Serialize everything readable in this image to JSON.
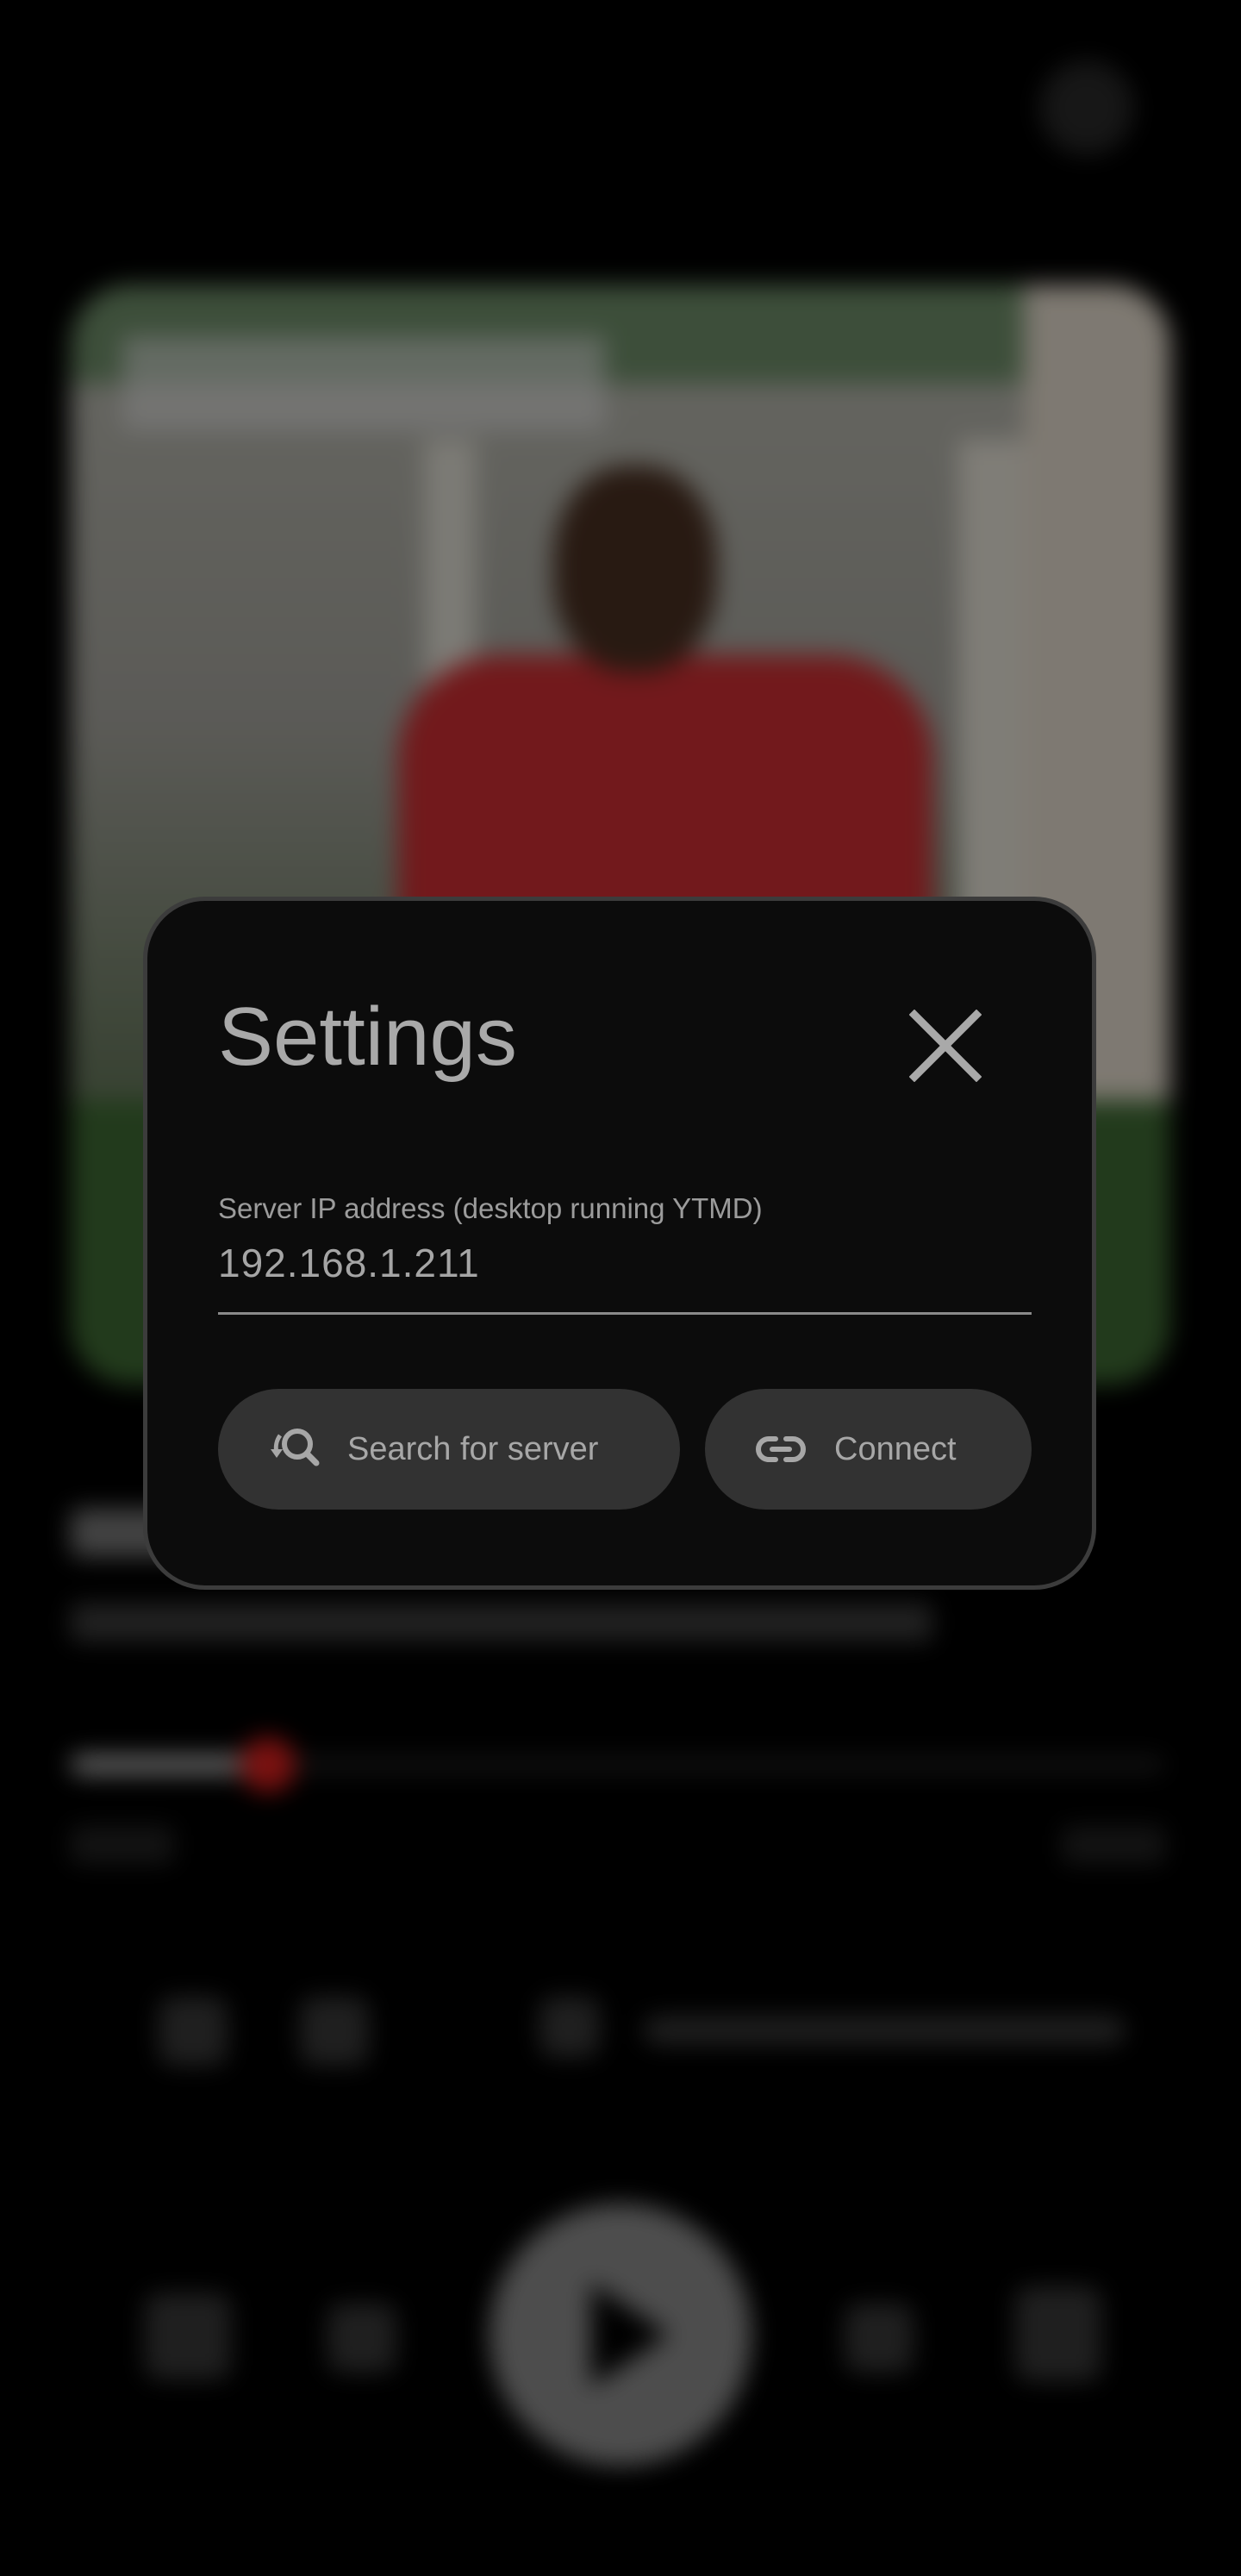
{
  "dialog": {
    "title": "Settings",
    "close_icon": "close-icon",
    "server_field": {
      "label": "Server IP address (desktop running YTMD)",
      "value": "192.168.1.211"
    },
    "buttons": {
      "search": {
        "label": "Search for server",
        "icon": "search-refresh-icon"
      },
      "connect": {
        "label": "Connect",
        "icon": "link-icon"
      }
    }
  },
  "player": {
    "progress": 0.18,
    "accent_color": "#e0211f",
    "icons": [
      "settings-icon",
      "like-icon",
      "dislike-icon",
      "volume-icon",
      "shuffle-icon",
      "previous-icon",
      "play-icon",
      "next-icon",
      "repeat-icon"
    ]
  }
}
